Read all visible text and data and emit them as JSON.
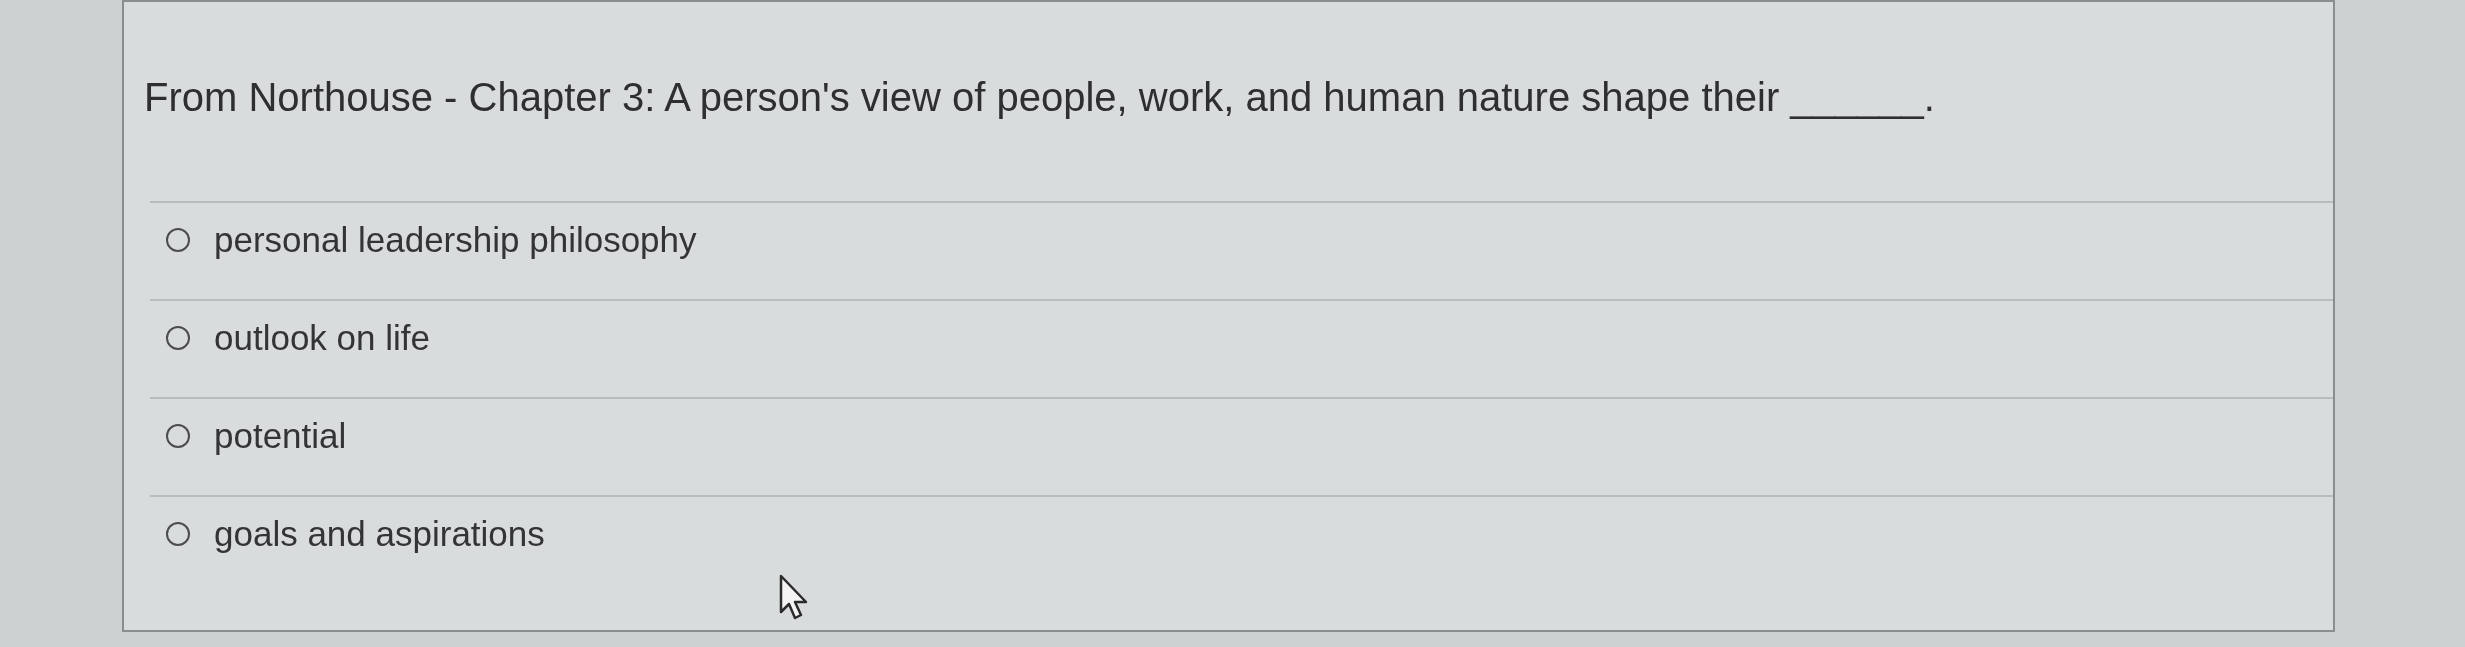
{
  "question": {
    "text": "From Northouse - Chapter 3: A person's view of people, work, and human nature shape their ______."
  },
  "options": [
    {
      "label": "personal leadership philosophy",
      "selected": false
    },
    {
      "label": "outlook on life",
      "selected": false
    },
    {
      "label": "potential",
      "selected": false
    },
    {
      "label": "goals and aspirations",
      "selected": false
    }
  ]
}
